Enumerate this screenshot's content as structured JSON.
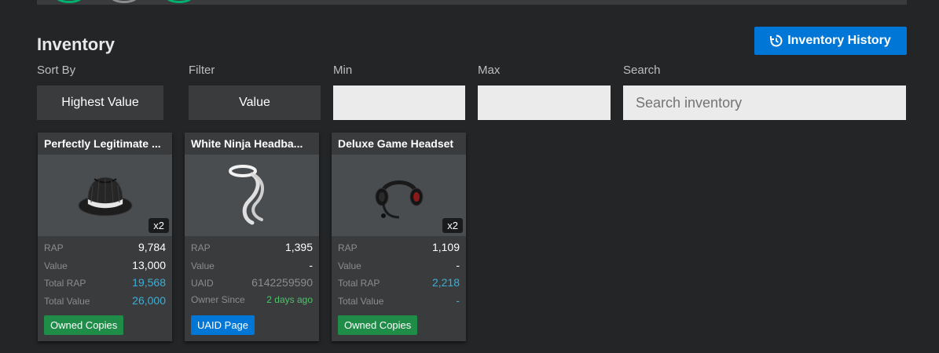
{
  "page": {
    "title": "Inventory",
    "history_button": "Inventory History"
  },
  "controls": {
    "sort_label": "Sort By",
    "sort_value": "Highest Value",
    "filter_label": "Filter",
    "filter_value": "Value",
    "min_label": "Min",
    "min_value": "",
    "max_label": "Max",
    "max_value": "",
    "search_label": "Search",
    "search_placeholder": "Search inventory"
  },
  "items": [
    {
      "name": "Perfectly Legitimate ...",
      "count": "x2",
      "stats": [
        {
          "label": "RAP",
          "value": "9,784"
        },
        {
          "label": "Value",
          "value": "13,000"
        },
        {
          "label": "Total RAP",
          "value": "19,568"
        },
        {
          "label": "Total Value",
          "value": "26,000"
        }
      ],
      "button": "Owned Copies"
    },
    {
      "name": "White Ninja Headba...",
      "count": "",
      "stats": [
        {
          "label": "RAP",
          "value": "1,395"
        },
        {
          "label": "Value",
          "value": "-"
        },
        {
          "label": "UAID",
          "value": "6142259590"
        },
        {
          "label": "Owner Since",
          "value": "2 days ago"
        }
      ],
      "button": "UAID Page"
    },
    {
      "name": "Deluxe Game Headset",
      "count": "x2",
      "stats": [
        {
          "label": "RAP",
          "value": "1,109"
        },
        {
          "label": "Value",
          "value": "-"
        },
        {
          "label": "Total RAP",
          "value": "2,218"
        },
        {
          "label": "Total Value",
          "value": "-"
        }
      ],
      "button": "Owned Copies"
    }
  ],
  "colors": {
    "background": "#232527",
    "panel": "#393b3d",
    "accent_blue": "#0077d6",
    "accent_green": "#1f8c48",
    "link_blue": "#3aafd8"
  },
  "icons": {
    "history": "history-icon"
  }
}
